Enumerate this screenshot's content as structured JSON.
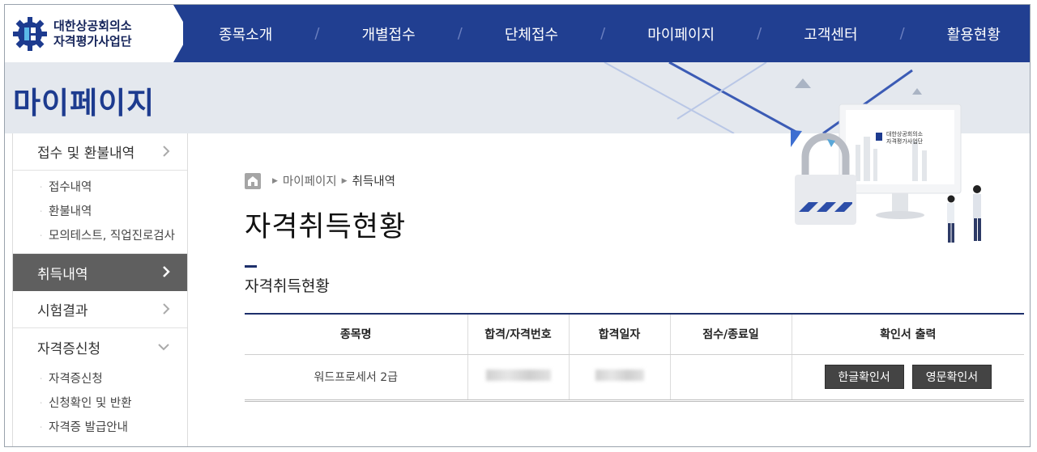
{
  "header": {
    "logo": {
      "line1": "대한상공회의소",
      "line2": "자격평가사업단"
    },
    "nav": [
      "종목소개",
      "개별접수",
      "단체접수",
      "마이페이지",
      "고객센터",
      "활용현황"
    ]
  },
  "page_title": "마이페이지",
  "sidebar": {
    "groups": [
      {
        "label": "접수 및 환불내역",
        "items": [
          "접수내역",
          "환불내역",
          "모의테스트, 직업진로검사"
        ]
      },
      {
        "label": "취득내역",
        "active": true
      },
      {
        "label": "시험결과"
      },
      {
        "label": "자격증신청",
        "items": [
          "자격증신청",
          "신청확인 및 반환",
          "자격증 발급안내"
        ]
      }
    ]
  },
  "breadcrumb": {
    "parent": "마이페이지",
    "current": "취득내역"
  },
  "heading": "자격취득현황",
  "section_title": "자격취득현황",
  "table": {
    "headers": [
      "종목명",
      "합격/자격번호",
      "합격일자",
      "점수/종료일",
      "확인서 출력"
    ],
    "rows": [
      {
        "name": "워드프로세서 2급",
        "score": "",
        "btn_kr": "한글확인서",
        "btn_en": "영문확인서"
      }
    ]
  },
  "illustration": {
    "monitor_text1": "대한상공회의소",
    "monitor_text2": "자격평가사업단"
  },
  "colors": {
    "navy": "#213f91",
    "title_blue": "#1d3b8f",
    "sidebar_active": "#5f5f5f"
  }
}
